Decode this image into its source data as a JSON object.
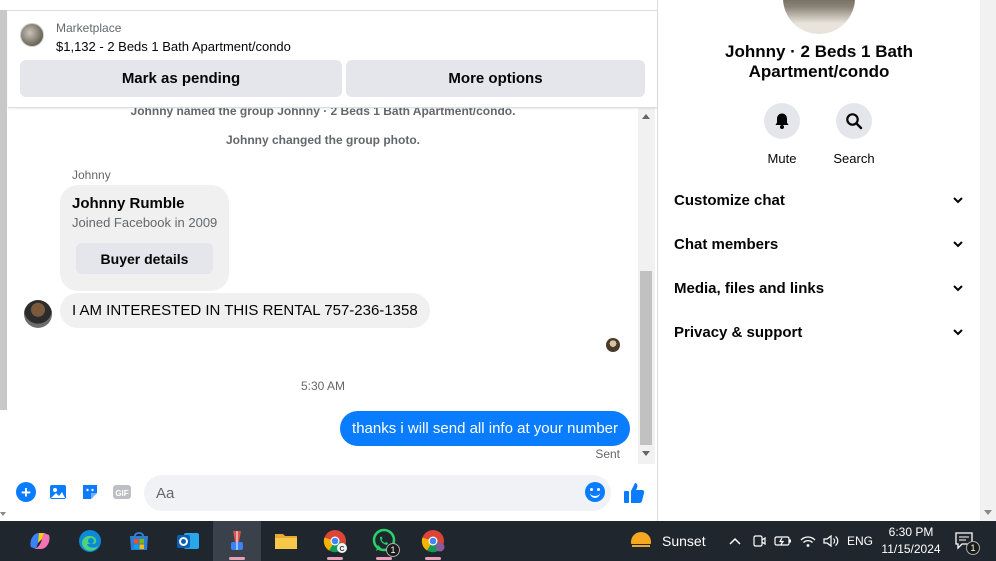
{
  "listing": {
    "source": "Marketplace",
    "title": "$1,132 - 2 Beds 1 Bath Apartment/condo",
    "mark_pending_label": "Mark as pending",
    "more_options_label": "More options"
  },
  "messages": {
    "system_events": [
      "Johnny named the group Johnny · 2 Beds 1 Bath Apartment/condo.",
      "Johnny changed the group photo."
    ],
    "sender_name": "Johnny",
    "buyer_card": {
      "name": "Johnny Rumble",
      "joined": "Joined Facebook in 2009",
      "button_label": "Buyer details"
    },
    "incoming_text": "I AM INTERESTED IN THIS RENTAL 757-236-1358",
    "timestamp": "5:30 AM",
    "outgoing_text": "thanks i will send all info at your number",
    "outgoing_status": "Sent"
  },
  "composer": {
    "placeholder": "Aa",
    "gif_label": "GIF",
    "icons": [
      "plus-icon",
      "image-icon",
      "sticker-icon",
      "gif-icon",
      "emoji-icon",
      "thumbs-up-icon"
    ]
  },
  "info_panel": {
    "group_name": "Johnny · 2 Beds 1 Bath Apartment/condo",
    "actions": [
      {
        "label": "Mute",
        "icon": "bell-icon"
      },
      {
        "label": "Search",
        "icon": "search-icon"
      }
    ],
    "sections": [
      "Customize chat",
      "Chat members",
      "Media, files and links",
      "Privacy & support"
    ]
  },
  "taskbar": {
    "apps": [
      "copilot",
      "edge",
      "microsoft-store",
      "outlook",
      "app-active",
      "file-explorer",
      "chrome-profile-c",
      "whatsapp",
      "chrome"
    ],
    "whatsapp_badge": "1",
    "weather_label": "Sunset",
    "language": "ENG",
    "time": "6:30 PM",
    "date": "11/15/2024",
    "notification_count": "1"
  },
  "colors": {
    "accent_blue": "#0a7cff",
    "bubble_gray": "#f0f0f0",
    "button_gray": "#e4e6eb",
    "taskbar_bg": "#20262e"
  }
}
